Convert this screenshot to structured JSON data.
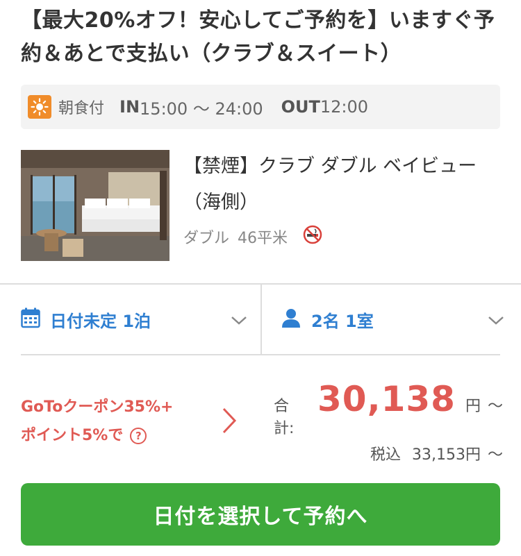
{
  "plan": {
    "title": "【最大20%オフ！安心してご予約を】いますぐ予約＆あとで支払い（クラブ＆スイート）"
  },
  "info": {
    "meal_icon": "sun-icon",
    "meal": "朝食付",
    "checkin_label": "IN",
    "checkin_time": "15:00 〜 24:00",
    "checkout_label": "OUT",
    "checkout_time": "12:00"
  },
  "room": {
    "name": "【禁煙】クラブ ダブル ベイビュー（海側）",
    "bed_type": "ダブル",
    "size": "46平米",
    "smoking_icon": "no-smoking-icon"
  },
  "selectors": {
    "date_label": "日付未定 1泊",
    "guests_label": "2名 1室"
  },
  "coupon": {
    "line1": "GoToクーポン35%+",
    "line2": "ポイント5%で",
    "help_glyph": "?"
  },
  "price": {
    "total_label": "合計:",
    "total_amount": "30,138",
    "currency": "円",
    "tilde": "〜",
    "tax_label": "税込",
    "tax_amount": "33,153円",
    "tax_tilde": "〜"
  },
  "cta": {
    "label": "日付を選択して予約へ"
  },
  "colors": {
    "accent_blue": "#2f7fd1",
    "price_red": "#e05a54",
    "button_green": "#3eaa3b",
    "meal_orange": "#f08c2a"
  }
}
